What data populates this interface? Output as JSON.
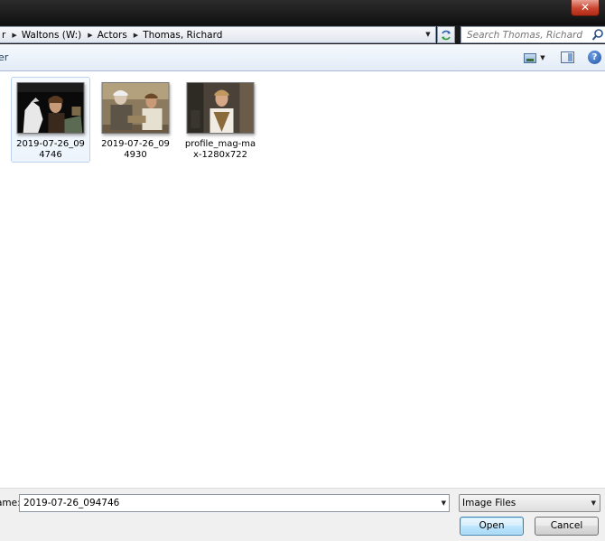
{
  "window": {
    "close_glyph": "✕"
  },
  "address": {
    "crumbs": [
      "r",
      "Waltons (W:)",
      "Actors",
      "Thomas, Richard"
    ],
    "search_placeholder": "Search Thomas, Richard"
  },
  "toolbar": {
    "label": "er"
  },
  "files": [
    {
      "name": "2019-07-26_094746",
      "selected": true
    },
    {
      "name": "2019-07-26_094930",
      "selected": false
    },
    {
      "name": "profile_mag-max-1280x722",
      "selected": false
    }
  ],
  "bottom": {
    "filename_label": "ame:",
    "filename_value": "2019-07-26_094746",
    "filetype_value": "Image Files",
    "open_label": "Open",
    "cancel_label": "Cancel"
  },
  "icons": {
    "close": "close-icon",
    "refresh": "refresh-icon",
    "search": "search-icon",
    "views": "views-icon",
    "preview_pane": "preview-pane-icon",
    "help": "help-icon"
  },
  "colors": {
    "toolbar_text": "#1e395b",
    "selection_border": "#bcd3ed",
    "close_button": "#c9452e",
    "default_button_border": "#3c7fb1"
  }
}
